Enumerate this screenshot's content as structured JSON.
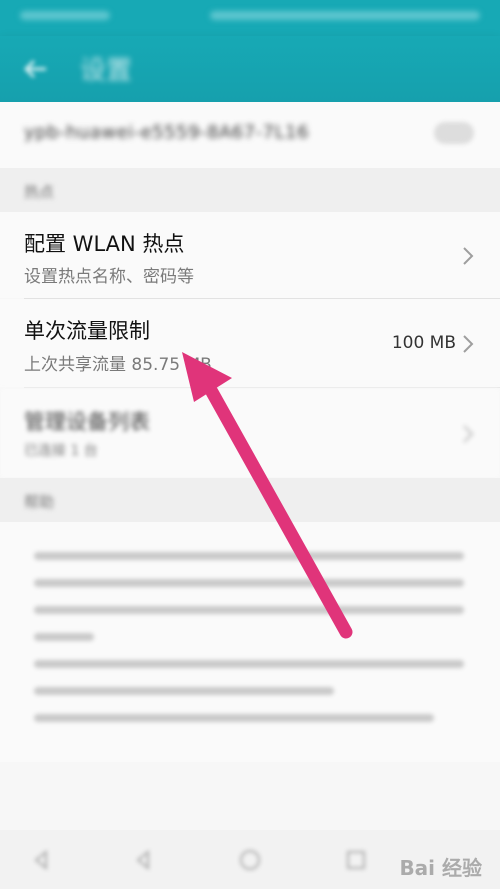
{
  "header": {
    "title": "设置"
  },
  "hotspot": {
    "ssid": "ypb-huawei-e5559-8A67-7L16"
  },
  "sections": {
    "hotspot_label": "热点",
    "help_label": "帮助"
  },
  "rows": [
    {
      "title": "配置 WLAN 热点",
      "subtitle": "设置热点名称、密码等",
      "value": ""
    },
    {
      "title": "单次流量限制",
      "subtitle": "上次共享流量 85.75 MB",
      "value": "100 MB"
    },
    {
      "title": "管理设备列表",
      "subtitle": "已连接 1 台",
      "value": ""
    }
  ],
  "watermark": "Bai 经验",
  "colors": {
    "accent": "#17a9b5",
    "annotation_arrow": "#e0347a"
  },
  "icons": [
    "back-arrow-icon",
    "toggle-switch",
    "chevron-right-icon",
    "annotation-arrow",
    "nav-back-icon",
    "nav-home-icon",
    "nav-recent-icon"
  ]
}
